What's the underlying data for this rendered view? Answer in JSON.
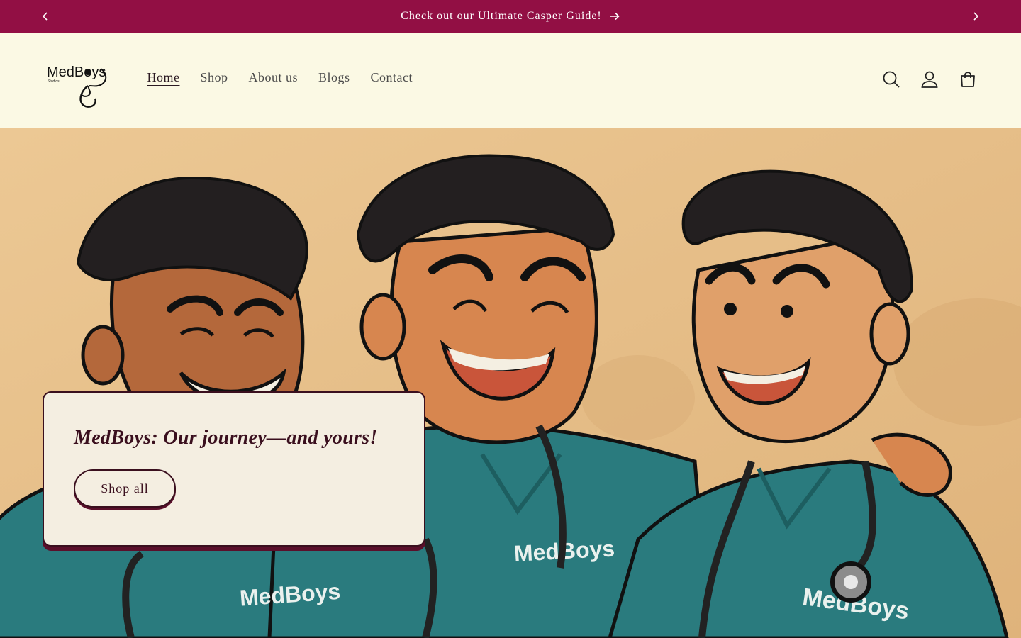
{
  "announcement": {
    "message": "Check out our Ultimate Casper Guide!",
    "prev_icon": "chevron-left-icon",
    "next_icon": "chevron-right-icon"
  },
  "header": {
    "logo_text": "MedBoys",
    "logo_subtext": "Studios",
    "nav": [
      {
        "label": "Home",
        "active": true
      },
      {
        "label": "Shop"
      },
      {
        "label": "About us"
      },
      {
        "label": "Blogs"
      },
      {
        "label": "Contact"
      }
    ],
    "icons": [
      "search-icon",
      "account-icon",
      "cart-icon"
    ]
  },
  "hero": {
    "heading": "MedBoys: Our journey—and yours!",
    "button_label": "Shop all",
    "shirt_text": "MedBoys"
  },
  "colors": {
    "announcement_bg": "#920f44",
    "header_bg": "#fbf9e4",
    "card_bg": "#f4eee1",
    "accent": "#3a0f1e",
    "scrubs": "#2a7b7e"
  }
}
